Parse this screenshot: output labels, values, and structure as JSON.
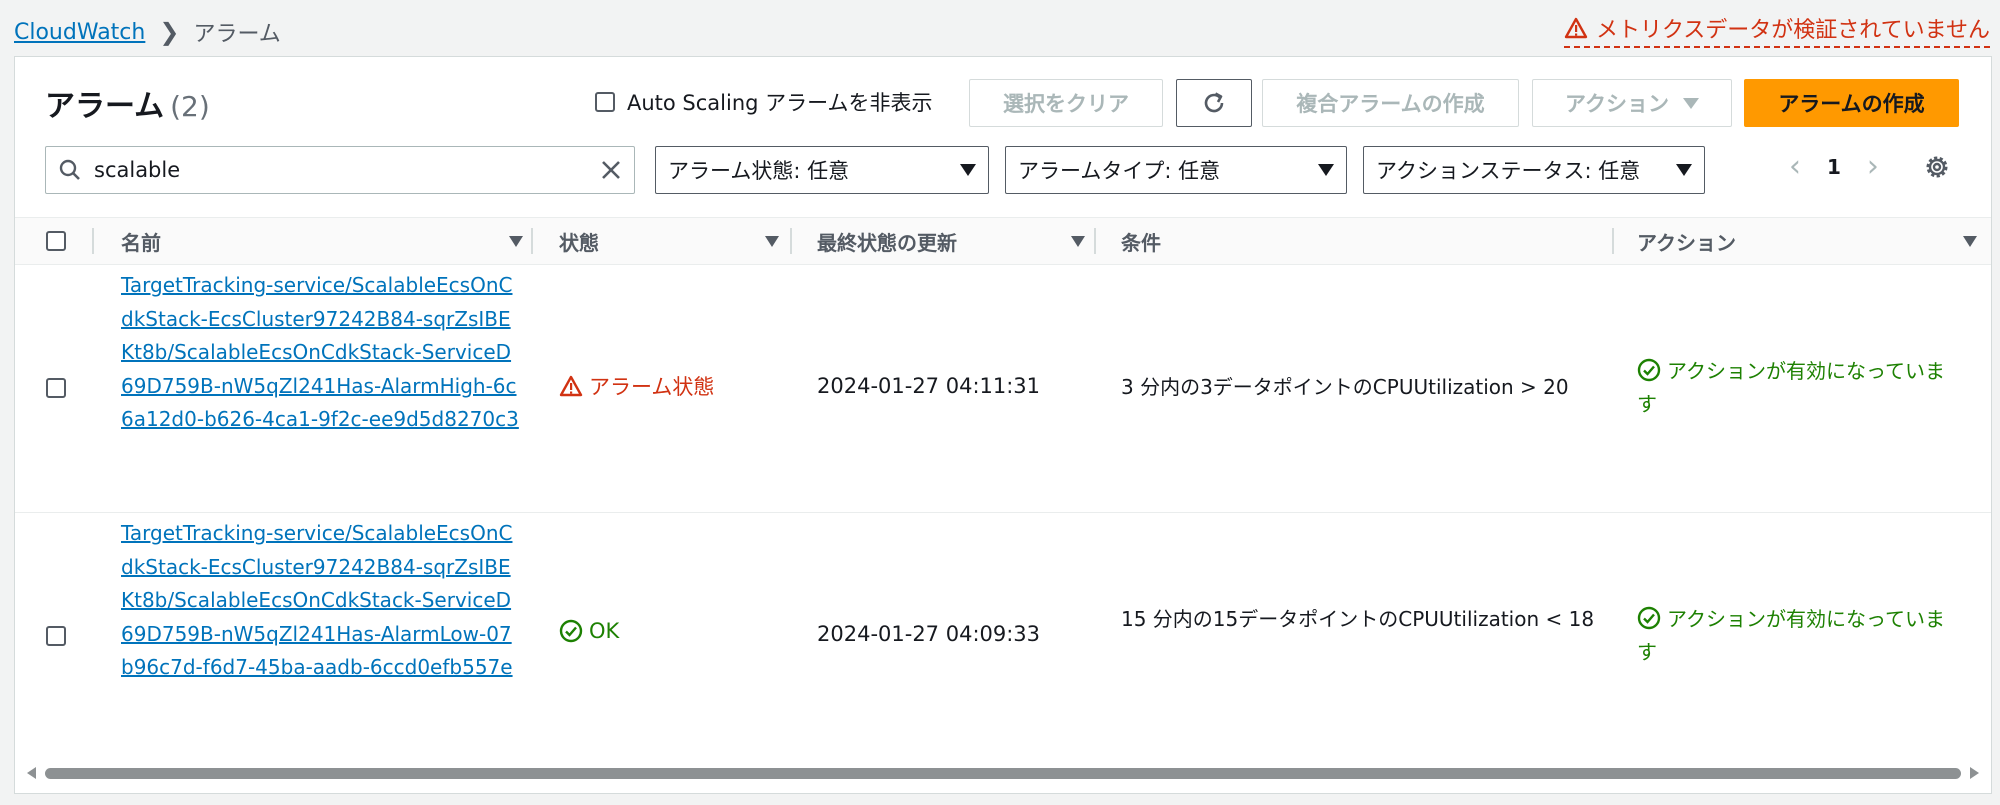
{
  "breadcrumb": {
    "root": "CloudWatch",
    "current": "アラーム"
  },
  "metric_warning": "メトリクスデータが検証されていません",
  "panel": {
    "title": "アラーム",
    "count": "(2)"
  },
  "toolbar": {
    "hide_autoscaling_label": "Auto Scaling アラームを非表示",
    "clear_selection": "選択をクリア",
    "create_composite": "複合アラームの作成",
    "actions": "アクション",
    "create_alarm": "アラームの作成"
  },
  "filters": {
    "search_value": "scalable",
    "alarm_state": "アラーム状態: 任意",
    "alarm_type": "アラームタイプ: 任意",
    "action_status": "アクションステータス: 任意"
  },
  "pagination": {
    "page": "1"
  },
  "table": {
    "headers": {
      "name": "名前",
      "state": "状態",
      "last_update": "最終状態の更新",
      "condition": "条件",
      "actions": "アクション"
    },
    "rows": [
      {
        "name": "TargetTracking-service/ScalableEcsOnCdkStack-EcsCluster97242B84-sqrZsIBEKt8b/ScalableEcsOnCdkStack-ServiceD69D759B-nW5qZl241Has-AlarmHigh-6c6a12d0-b626-4ca1-9f2c-ee9d5d8270c3",
        "state": "アラーム状態",
        "last_update": "2024-01-27 04:11:31",
        "condition": "3 分内の3データポイントのCPUUtilization > 20",
        "actions": "アクションが有効になっています"
      },
      {
        "name": "TargetTracking-service/ScalableEcsOnCdkStack-EcsCluster97242B84-sqrZsIBEKt8b/ScalableEcsOnCdkStack-ServiceD69D759B-nW5qZl241Has-AlarmLow-07b96c7d-f6d7-45ba-aadb-6ccd0efb557e",
        "state": "OK",
        "last_update": "2024-01-27 04:09:33",
        "condition": "15 分内の15データポイントのCPUUtilization < 18",
        "actions": "アクションが有効になっています"
      }
    ]
  },
  "colors": {
    "link": "#0073bb",
    "alarm": "#d13212",
    "ok": "#1d8102",
    "primary": "#ff9900"
  }
}
